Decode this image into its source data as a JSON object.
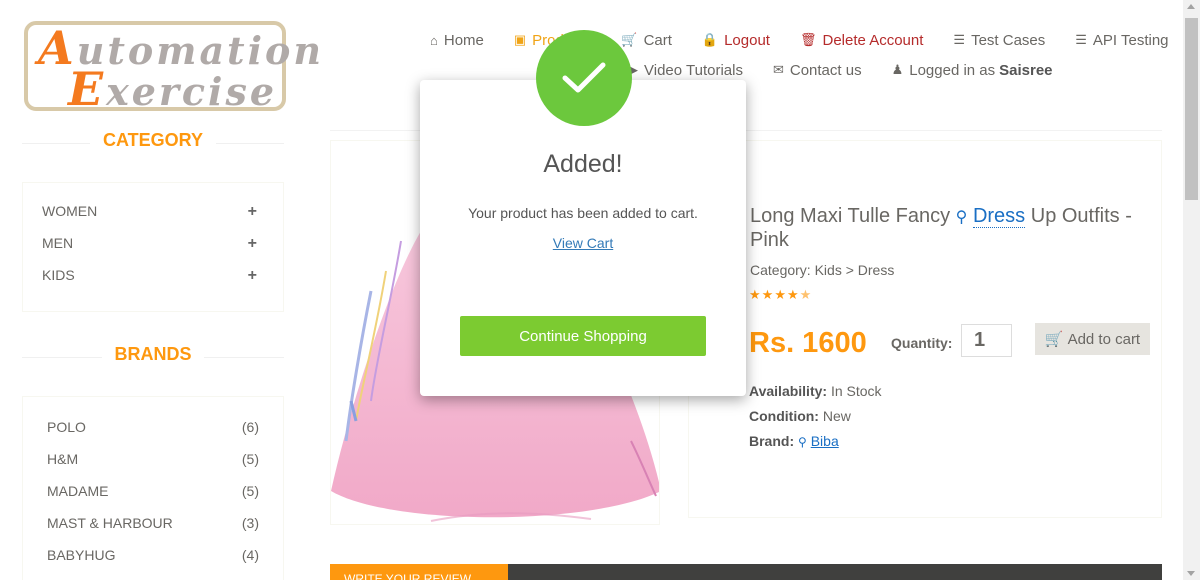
{
  "logo": {
    "line1_cap": "A",
    "line1_rest": "utomation",
    "line2_cap": "E",
    "line2_rest": "xercise"
  },
  "nav": {
    "home": "Home",
    "products": "Products",
    "cart": "Cart",
    "logout": "Logout",
    "delete_account": "Delete Account",
    "test_cases": "Test Cases",
    "api_testing": "API Testing",
    "video_tutorials": "Video Tutorials",
    "contact_us": "Contact us",
    "logged_in_as": "Logged in as",
    "username": "Saisree"
  },
  "sidebar": {
    "category_title": "CATEGORY",
    "categories": [
      {
        "label": "WOMEN",
        "toggle": "+"
      },
      {
        "label": "MEN",
        "toggle": "+"
      },
      {
        "label": "KIDS",
        "toggle": "+"
      }
    ],
    "brands_title": "BRANDS",
    "brands": [
      {
        "name": "POLO",
        "count": "(6)"
      },
      {
        "name": "H&M",
        "count": "(5)"
      },
      {
        "name": "MADAME",
        "count": "(5)"
      },
      {
        "name": "MAST & HARBOUR",
        "count": "(3)"
      },
      {
        "name": "BABYHUG",
        "count": "(4)"
      }
    ]
  },
  "product": {
    "title_part1": "Long Maxi Tulle Fancy",
    "title_highlight": "Dress",
    "title_part2": "Up Outfits - Pink",
    "category": "Category: Kids > Dress",
    "rating": 4.5,
    "price": "Rs. 1600",
    "quantity_label": "Quantity:",
    "quantity_value": "1",
    "add_to_cart": "Add to cart",
    "availability_label": "Availability:",
    "availability_value": "In Stock",
    "condition_label": "Condition:",
    "condition_value": "New",
    "brand_label": "Brand:",
    "brand_value": "Biba"
  },
  "review_tab": "WRITE YOUR REVIEW",
  "modal": {
    "title": "Added!",
    "message": "Your product has been added to cart.",
    "view_cart": "View Cart",
    "continue": "Continue Shopping"
  },
  "colors": {
    "accent": "#fe980f",
    "success": "#7ccb31",
    "link": "#337ab7"
  }
}
